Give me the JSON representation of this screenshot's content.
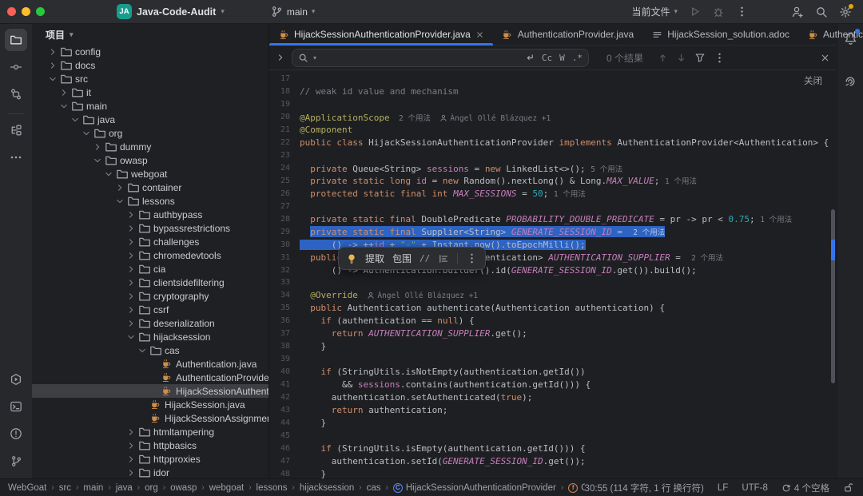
{
  "titlebar": {
    "project_badge": "JA",
    "project_name": "Java-Code-Audit",
    "branch_name": "main",
    "run_config": "当前文件"
  },
  "project_panel": {
    "header": "项目",
    "tree": [
      {
        "label": "config",
        "lvl": 1,
        "kind": "dir",
        "st": "closed"
      },
      {
        "label": "docs",
        "lvl": 1,
        "kind": "dir",
        "st": "closed"
      },
      {
        "label": "src",
        "lvl": 1,
        "kind": "dir",
        "st": "open"
      },
      {
        "label": "it",
        "lvl": 2,
        "kind": "dir",
        "st": "closed"
      },
      {
        "label": "main",
        "lvl": 2,
        "kind": "dir",
        "st": "open"
      },
      {
        "label": "java",
        "lvl": 3,
        "kind": "dir",
        "st": "open"
      },
      {
        "label": "org",
        "lvl": 4,
        "kind": "dir",
        "st": "open"
      },
      {
        "label": "dummy",
        "lvl": 5,
        "kind": "dir",
        "st": "closed"
      },
      {
        "label": "owasp",
        "lvl": 5,
        "kind": "dir",
        "st": "open"
      },
      {
        "label": "webgoat",
        "lvl": 6,
        "kind": "dir",
        "st": "open"
      },
      {
        "label": "container",
        "lvl": 7,
        "kind": "dir",
        "st": "closed"
      },
      {
        "label": "lessons",
        "lvl": 7,
        "kind": "dir",
        "st": "open"
      },
      {
        "label": "authbypass",
        "lvl": 8,
        "kind": "dir",
        "st": "closed"
      },
      {
        "label": "bypassrestrictions",
        "lvl": 8,
        "kind": "dir",
        "st": "closed"
      },
      {
        "label": "challenges",
        "lvl": 8,
        "kind": "dir",
        "st": "closed"
      },
      {
        "label": "chromedevtools",
        "lvl": 8,
        "kind": "dir",
        "st": "closed"
      },
      {
        "label": "cia",
        "lvl": 8,
        "kind": "dir",
        "st": "closed"
      },
      {
        "label": "clientsidefiltering",
        "lvl": 8,
        "kind": "dir",
        "st": "closed"
      },
      {
        "label": "cryptography",
        "lvl": 8,
        "kind": "dir",
        "st": "closed"
      },
      {
        "label": "csrf",
        "lvl": 8,
        "kind": "dir",
        "st": "closed"
      },
      {
        "label": "deserialization",
        "lvl": 8,
        "kind": "dir",
        "st": "closed"
      },
      {
        "label": "hijacksession",
        "lvl": 8,
        "kind": "dir",
        "st": "open"
      },
      {
        "label": "cas",
        "lvl": 9,
        "kind": "dir",
        "st": "open"
      },
      {
        "label": "Authentication.java",
        "lvl": 10,
        "kind": "java",
        "st": "leaf"
      },
      {
        "label": "AuthenticationProvider.java",
        "lvl": 10,
        "kind": "java",
        "st": "leaf"
      },
      {
        "label": "HijackSessionAuthenticationProvider.java",
        "lvl": 10,
        "kind": "java",
        "st": "leaf",
        "sel": true
      },
      {
        "label": "HijackSession.java",
        "lvl": 9,
        "kind": "java",
        "st": "leaf"
      },
      {
        "label": "HijackSessionAssignment.java",
        "lvl": 9,
        "kind": "java",
        "st": "leaf"
      },
      {
        "label": "htmltampering",
        "lvl": 8,
        "kind": "dir",
        "st": "closed"
      },
      {
        "label": "httpbasics",
        "lvl": 8,
        "kind": "dir",
        "st": "closed"
      },
      {
        "label": "httpproxies",
        "lvl": 8,
        "kind": "dir",
        "st": "closed"
      },
      {
        "label": "idor",
        "lvl": 8,
        "kind": "dir",
        "st": "closed"
      }
    ]
  },
  "tabs": [
    {
      "label": "HijackSessionAuthenticationProvider.java",
      "icon": "java",
      "active": true,
      "closable": true
    },
    {
      "label": "AuthenticationProvider.java",
      "icon": "java"
    },
    {
      "label": "HijackSession_solution.adoc",
      "icon": "adoc"
    },
    {
      "label": "Authentication.java",
      "icon": "java",
      "truncated": true
    }
  ],
  "find_bar": {
    "input_value": "",
    "match_case": "Cc",
    "words": "W",
    "regex": ".*",
    "results_text": "0 个结果"
  },
  "editor": {
    "close_link": "关闭",
    "popup": {
      "extract": "提取",
      "surround": "包围",
      "slashes": "//"
    },
    "lines": [
      {
        "n": 17,
        "segs": []
      },
      {
        "n": 18,
        "segs": [
          [
            "c",
            "// weak id value and mechanism"
          ]
        ]
      },
      {
        "n": 19,
        "segs": []
      },
      {
        "n": 20,
        "segs": [
          [
            "a",
            "@ApplicationScope"
          ],
          [
            "i",
            "  2 个用法  "
          ],
          [
            "au",
            "Àngel Ollé Blázquez +1"
          ]
        ]
      },
      {
        "n": 21,
        "segs": [
          [
            "a",
            "@Component"
          ]
        ]
      },
      {
        "n": 22,
        "segs": [
          [
            "k",
            "public class "
          ],
          [
            "d",
            "HijackSessionAuthenticationProvider "
          ],
          [
            "k",
            "implements "
          ],
          [
            "d",
            "AuthenticationProvider<Authentication> {"
          ]
        ]
      },
      {
        "n": 23,
        "segs": []
      },
      {
        "n": 24,
        "segs": [
          [
            "k",
            "  private "
          ],
          [
            "d",
            "Queue<String> "
          ],
          [
            "f",
            "sessions"
          ],
          [
            "d",
            " = "
          ],
          [
            "k",
            "new "
          ],
          [
            "d",
            "LinkedList<>(); "
          ],
          [
            "i",
            "5 个用法"
          ]
        ]
      },
      {
        "n": 25,
        "segs": [
          [
            "k",
            "  private static long "
          ],
          [
            "f",
            "id"
          ],
          [
            "d",
            " = "
          ],
          [
            "k",
            "new "
          ],
          [
            "d",
            "Random().nextLong() & Long."
          ],
          [
            "C",
            "MAX_VALUE"
          ],
          [
            "d",
            "; "
          ],
          [
            "i",
            "1 个用法"
          ]
        ]
      },
      {
        "n": 26,
        "segs": [
          [
            "k",
            "  protected static final int "
          ],
          [
            "C",
            "MAX_SESSIONS"
          ],
          [
            "d",
            " = "
          ],
          [
            "n",
            "50"
          ],
          [
            "d",
            "; "
          ],
          [
            "i",
            "1 个用法"
          ]
        ]
      },
      {
        "n": 27,
        "segs": []
      },
      {
        "n": 28,
        "segs": [
          [
            "k",
            "  private static final "
          ],
          [
            "d",
            "DoublePredicate "
          ],
          [
            "C",
            "PROBABILITY_DOUBLE_PREDICATE"
          ],
          [
            "d",
            " = pr -> pr < "
          ],
          [
            "n",
            "0.75"
          ],
          [
            "d",
            "; "
          ],
          [
            "i",
            "1 个用法"
          ]
        ]
      },
      {
        "n": 29,
        "sel": "full",
        "selStart": 1,
        "segs": [
          [
            "k",
            "  "
          ],
          [
            "k",
            "private static final "
          ],
          [
            "d",
            "Supplier<String> "
          ],
          [
            "C",
            "GENERATE_SESSION_ID"
          ],
          [
            "d",
            " =  "
          ],
          [
            "i",
            "2 个用法"
          ]
        ]
      },
      {
        "n": 30,
        "sel": "text",
        "selStart": 0,
        "segs": [
          [
            "d",
            "      () -> ++"
          ],
          [
            "f",
            "id"
          ],
          [
            "d",
            " + "
          ],
          [
            "s",
            "\"-\""
          ],
          [
            "d",
            " + Instant.now().toEpochMilli();"
          ]
        ]
      },
      {
        "n": 31,
        "segs": [
          [
            "k",
            "  public static final "
          ],
          [
            "d",
            "Supplier<Authentication> "
          ],
          [
            "C",
            "AUTHENTICATION_SUPPLIER"
          ],
          [
            "d",
            " =  "
          ],
          [
            "i",
            "2 个用法"
          ]
        ]
      },
      {
        "n": 32,
        "segs": [
          [
            "d",
            "      () -> Authentication.builder().id("
          ],
          [
            "C",
            "GENERATE_SESSION_ID"
          ],
          [
            "d",
            ".get()).build();"
          ]
        ]
      },
      {
        "n": 33,
        "segs": []
      },
      {
        "n": 34,
        "segs": [
          [
            "a",
            "  @Override"
          ],
          [
            "i",
            "  "
          ],
          [
            "au",
            "Àngel Ollé Blázquez +1"
          ]
        ]
      },
      {
        "n": 35,
        "segs": [
          [
            "k",
            "  public "
          ],
          [
            "d",
            "Authentication authenticate(Authentication authentication) {"
          ]
        ]
      },
      {
        "n": 36,
        "segs": [
          [
            "k",
            "    if "
          ],
          [
            "d",
            "(authentication == "
          ],
          [
            "k",
            "null"
          ],
          [
            "d",
            ") {"
          ]
        ]
      },
      {
        "n": 37,
        "segs": [
          [
            "k",
            "      return "
          ],
          [
            "C",
            "AUTHENTICATION_SUPPLIER"
          ],
          [
            "d",
            ".get();"
          ]
        ]
      },
      {
        "n": 38,
        "segs": [
          [
            "d",
            "    }"
          ]
        ]
      },
      {
        "n": 39,
        "segs": []
      },
      {
        "n": 40,
        "segs": [
          [
            "k",
            "    if "
          ],
          [
            "d",
            "(StringUtils.isNotEmpty(authentication.getId())"
          ]
        ]
      },
      {
        "n": 41,
        "segs": [
          [
            "d",
            "        && "
          ],
          [
            "f",
            "sessions"
          ],
          [
            "d",
            ".contains(authentication.getId())) {"
          ]
        ]
      },
      {
        "n": 42,
        "segs": [
          [
            "d",
            "      authentication.setAuthenticated("
          ],
          [
            "k",
            "true"
          ],
          [
            "d",
            ");"
          ]
        ]
      },
      {
        "n": 43,
        "segs": [
          [
            "k",
            "      return "
          ],
          [
            "d",
            "authentication;"
          ]
        ]
      },
      {
        "n": 44,
        "segs": [
          [
            "d",
            "    }"
          ]
        ]
      },
      {
        "n": 45,
        "segs": []
      },
      {
        "n": 46,
        "segs": [
          [
            "k",
            "    if "
          ],
          [
            "d",
            "(StringUtils.isEmpty(authentication.getId())) {"
          ]
        ]
      },
      {
        "n": 47,
        "segs": [
          [
            "d",
            "      authentication.setId("
          ],
          [
            "C",
            "GENERATE_SESSION_ID"
          ],
          [
            "d",
            ".get());"
          ]
        ]
      },
      {
        "n": 48,
        "segs": [
          [
            "d",
            "    }"
          ]
        ]
      }
    ]
  },
  "breadcrumbs": {
    "items": [
      "WebGoat",
      "src",
      "main",
      "java",
      "org",
      "owasp",
      "webgoat",
      "lessons",
      "hijacksession",
      "cas"
    ],
    "class_item": "HijackSessionAuthenticationProvider",
    "member_item": "GENERATE_SESSION_ID"
  },
  "status_right": {
    "position": "30:55 (114 字符, 1 行 换行符)",
    "line_sep": "LF",
    "encoding": "UTF-8",
    "indent": "4 个空格"
  },
  "colors": {
    "accent": "#3574f0",
    "selection": "#2d63c2",
    "project_badge": "#169e8c",
    "gear_dot": "#e0a80d",
    "bell_dot": "#3574f0"
  }
}
